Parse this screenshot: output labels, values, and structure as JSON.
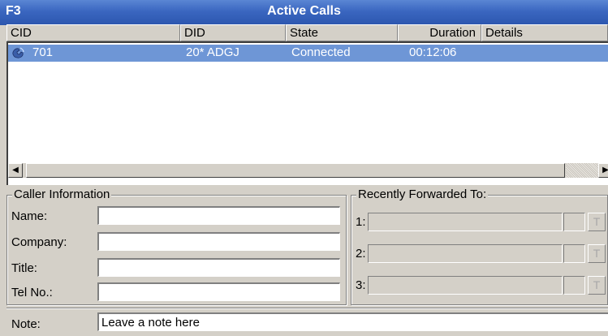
{
  "window": {
    "hotkey": "F3",
    "title": "Active Calls"
  },
  "calls_table": {
    "columns": [
      "CID",
      "DID",
      "State",
      "Duration",
      "Details"
    ],
    "rows": [
      {
        "cid": "701",
        "did": "20* ADGJ",
        "state": "Connected",
        "duration": "00:12:06",
        "details": ""
      }
    ],
    "selection_color": "#6e96d6"
  },
  "caller_info": {
    "legend": "Caller Information",
    "name_label": "Name:",
    "company_label": "Company:",
    "title_label": "Title:",
    "tel_label": "Tel No.:",
    "name_value": "",
    "company_value": "",
    "title_value": "",
    "tel_value": ""
  },
  "recently_forwarded": {
    "legend": "Recently Forwarded To:",
    "slots": [
      {
        "label": "1:",
        "button": "T"
      },
      {
        "label": "2:",
        "button": "T"
      },
      {
        "label": "3:",
        "button": "T"
      }
    ]
  },
  "note": {
    "label": "Note:",
    "value": "Leave a note here"
  },
  "icons": {
    "call": "phone-call-icon",
    "scroll_left": "arrow-left-icon",
    "scroll_right": "arrow-right-icon"
  },
  "colors": {
    "titlebar": "#3a66c0",
    "selection": "#6e96d6",
    "face": "#d4d0c8"
  }
}
